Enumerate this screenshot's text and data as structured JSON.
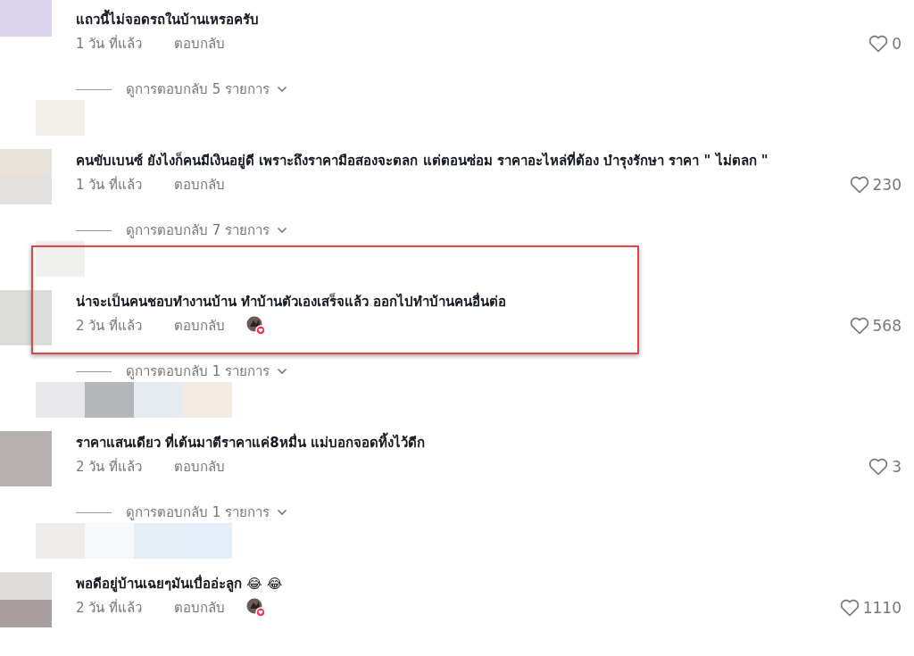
{
  "comments": [
    {
      "text": "แถวนี้ไม่จอดรถในบ้านเหรอครับ",
      "time": "1 วัน ที่แล้ว",
      "reply": "ตอบกลับ",
      "likes": "0",
      "creator_liked": false,
      "highlighted": false,
      "replies": "ดูการตอบกลับ 5 รายการ"
    },
    {
      "text": "คนขับเบนซ์ ยังไงก็คนมีเงินอยู่ดี เพราะถึงราคามือสองจะตลก แต่ตอนซ่อม ราคาอะไหล่ที่ต้อง บำรุงรักษา ราคา \" ไม่ตลก \"",
      "time": "1 วัน ที่แล้ว",
      "reply": "ตอบกลับ",
      "likes": "230",
      "creator_liked": false,
      "highlighted": false,
      "replies": "ดูการตอบกลับ 7 รายการ"
    },
    {
      "text": "น่าจะเป็นคนชอบทำงานบ้าน ทำบ้านตัวเองเสร็จแล้ว ออกไปทำบ้านคนอื่นต่อ",
      "time": "2 วัน ที่แล้ว",
      "reply": "ตอบกลับ",
      "likes": "568",
      "creator_liked": true,
      "highlighted": true,
      "replies": "ดูการตอบกลับ 1 รายการ"
    },
    {
      "text": "ราคาแสนเดียว ที่เต้นมาตีราคาแค่8หมื่น แม่บอกจอดทิ้งไว้ดีก",
      "time": "2 วัน ที่แล้ว",
      "reply": "ตอบกลับ",
      "likes": "3",
      "creator_liked": false,
      "highlighted": false,
      "replies": "ดูการตอบกลับ 1 รายการ"
    },
    {
      "text": "พอดีอยู่บ้านเฉยๆมันเบื่ออ่ะลูก 😂 😂",
      "time": "2 วัน ที่แล้ว",
      "reply": "ตอบกลับ",
      "likes": "1110",
      "creator_liked": true,
      "highlighted": false
    }
  ]
}
